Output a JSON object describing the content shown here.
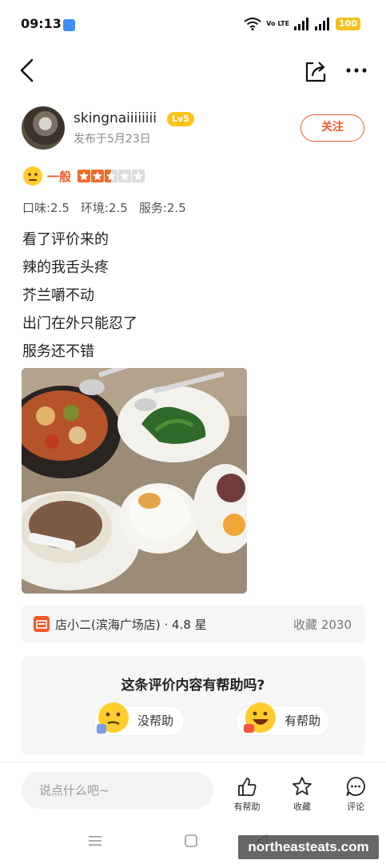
{
  "status_bar": {
    "time": "09:13",
    "network": "Vo LTE",
    "battery": "100"
  },
  "nav": {
    "back_icon": "chevron-left-icon",
    "share_icon": "share-icon",
    "more_icon": "more-dots-icon"
  },
  "author": {
    "name": "skingnaiiiiiiii",
    "level": "Lv5",
    "date": "发布于5月23日",
    "follow_label": "关注"
  },
  "rating": {
    "label": "一般",
    "stars": 2.5,
    "max_stars": 5,
    "sub_ratings": [
      "口味:2.5",
      "环境:2.5",
      "服务:2.5"
    ],
    "accent_color": "#f05a28"
  },
  "review": {
    "lines": [
      "看了评价来的",
      "辣的我舌头疼",
      "芥兰嚼不动",
      "出门在外只能忍了",
      "服务还不错"
    ]
  },
  "shop": {
    "name": "店小二(滨海广场店) · 4.8 星",
    "favorites": "收藏 2030"
  },
  "helpful": {
    "question": "这条评价内容有帮助吗?",
    "no_label": "没帮助",
    "yes_label": "有帮助"
  },
  "bottom_bar": {
    "input_placeholder": "说点什么吧~",
    "helpful_label": "有帮助",
    "collect_label": "收藏",
    "comment_label": "评论"
  },
  "watermark": "northeasteats.com"
}
